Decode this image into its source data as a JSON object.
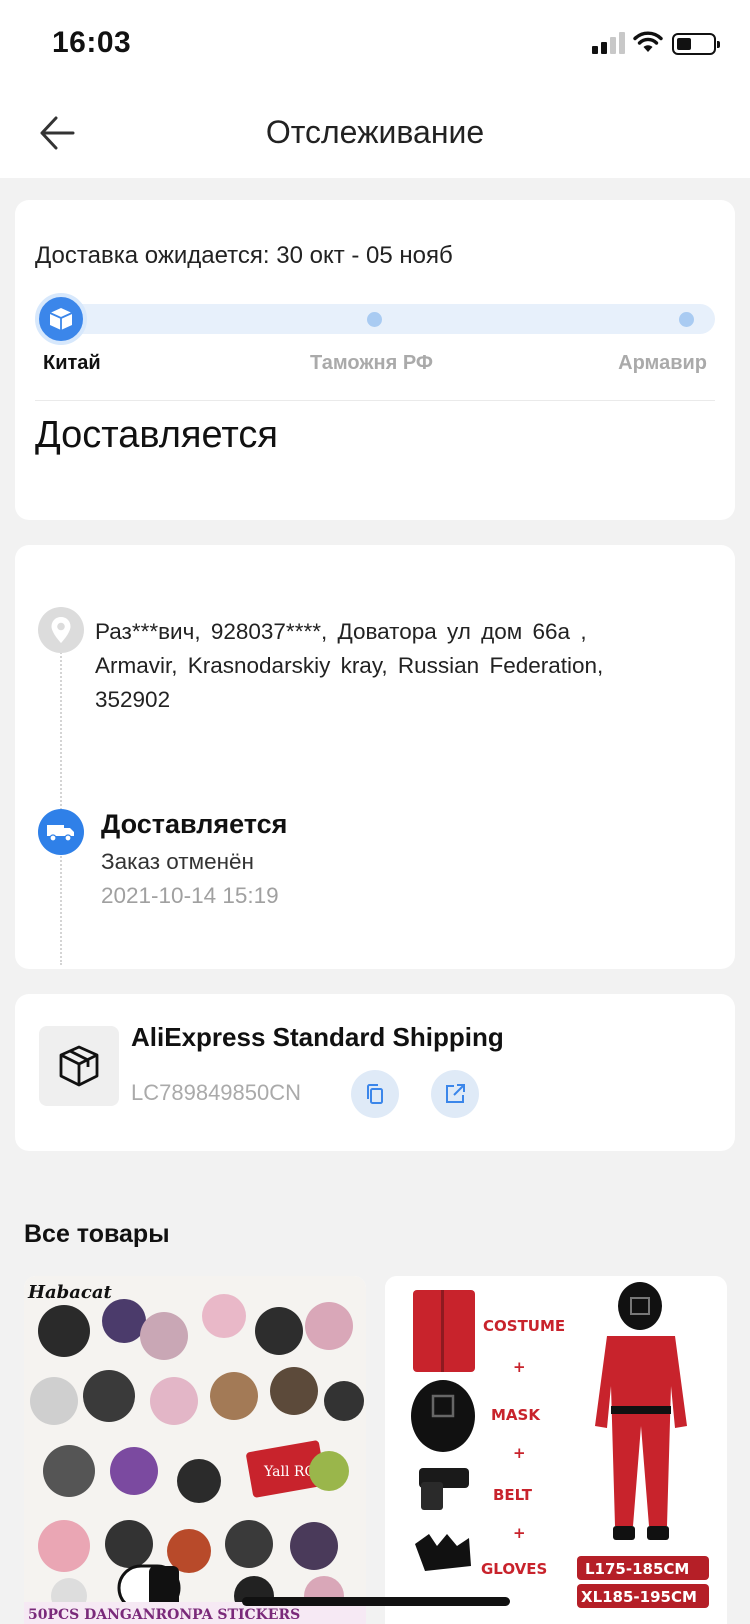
{
  "status_bar": {
    "time": "16:03"
  },
  "header": {
    "title": "Отслеживание"
  },
  "delivery": {
    "eta": "Доставка ожидается: 30 окт - 05 нояб",
    "stages": [
      "Китай",
      "Таможня РФ",
      "Армавир"
    ],
    "current_stage_index": 0,
    "status": "Доставляется"
  },
  "timeline": {
    "address": "Раз***вич,  928037****,  Доватора ул дом 66а ,  Armavir,  Krasnodarskiy kray,  Russian Federation,  352902",
    "event": {
      "title": "Доставляется",
      "description": "Заказ отменён",
      "time": "2021-10-14 15:19"
    }
  },
  "shipping": {
    "method": "AliExpress Standard Shipping",
    "tracking_number": "LC789849850CN"
  },
  "products": {
    "title": "Все товары",
    "items": [
      {
        "brand": "Habacat",
        "caption": "50PCS DANGANRONPA STICKERS",
        "sign_text": "Yall RON G"
      },
      {
        "labels": [
          "COSTUME",
          "+",
          "MASK",
          "+",
          "BELT",
          "+",
          "GLOVES"
        ],
        "sizes": [
          "L175-185CM",
          "XL185-195CM"
        ]
      }
    ]
  },
  "colors": {
    "accent_blue": "#3b86ea",
    "track_bg": "#e7f0fb",
    "costume_red": "#c8232c"
  },
  "icons": [
    "back-arrow-icon",
    "package-icon",
    "location-pin-icon",
    "truck-icon",
    "box-icon",
    "copy-icon",
    "external-link-icon"
  ]
}
